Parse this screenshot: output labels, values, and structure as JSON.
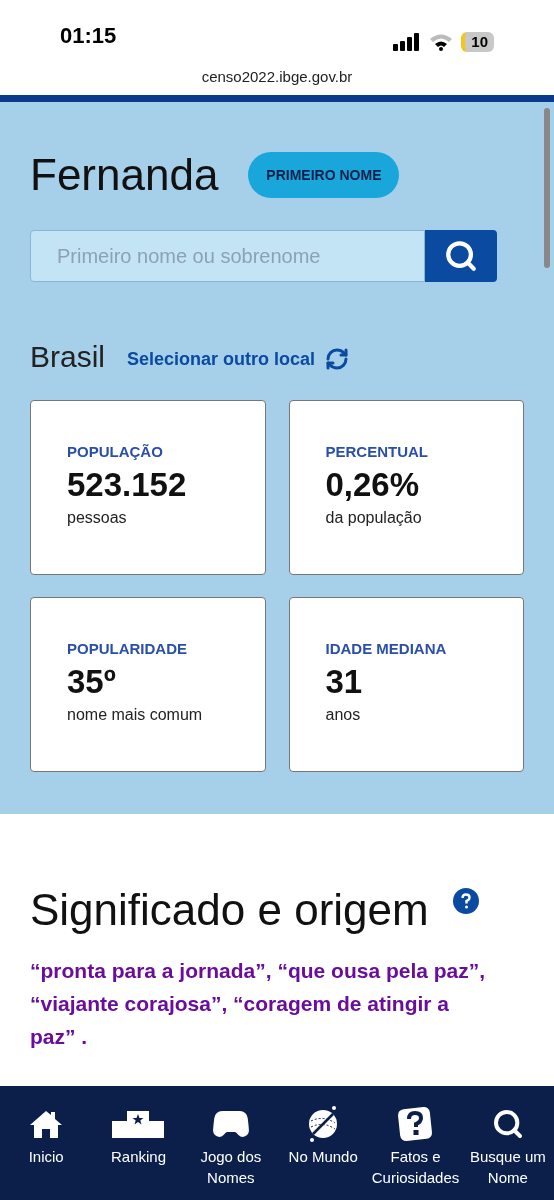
{
  "status_bar": {
    "time": "01:15",
    "battery": "10"
  },
  "address_bar": {
    "url": "censo2022.ibge.gov.br"
  },
  "name_header": {
    "name": "Fernanda",
    "badge": "PRIMEIRO NOME"
  },
  "search": {
    "placeholder": "Primeiro nome ou sobrenome"
  },
  "location": {
    "name": "Brasil",
    "link": "Selecionar outro local"
  },
  "stats": [
    {
      "label": "POPULAÇÃO",
      "value": "523.152",
      "caption": "pessoas"
    },
    {
      "label": "PERCENTUAL",
      "value": "0,26%",
      "caption": "da população"
    },
    {
      "label": "POPULARIDADE",
      "value": "35º",
      "caption": "nome mais comum"
    },
    {
      "label": "IDADE MEDIANA",
      "value": "31",
      "caption": "anos"
    }
  ],
  "meaning": {
    "title": "Significado e origem",
    "highlight": "“pronta para a jornada”, “que ousa pela paz”, “viajante corajosa”, “coragem de atingir a paz” ."
  },
  "bottom_nav": [
    {
      "kind": "home",
      "label": "Inicio"
    },
    {
      "kind": "podium",
      "label": "Ranking"
    },
    {
      "kind": "gamepad",
      "label": "Jogo dos Nomes"
    },
    {
      "kind": "globe",
      "label": "No Mundo"
    },
    {
      "kind": "question",
      "label": "Fatos e Curiosidades"
    },
    {
      "kind": "search",
      "label": "Busque um Nome"
    }
  ]
}
